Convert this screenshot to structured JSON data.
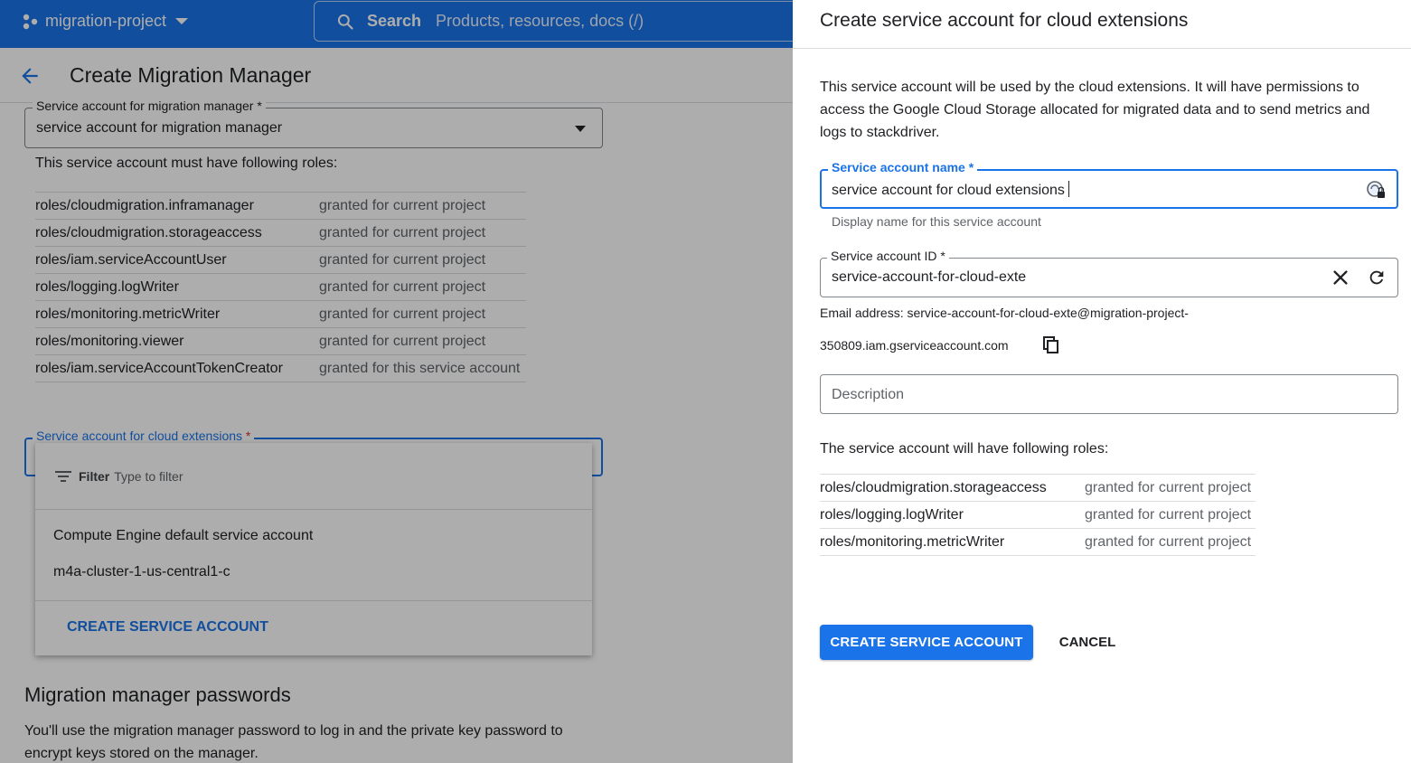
{
  "topbar": {
    "project_name": "migration-project",
    "search_label": "Search",
    "search_placeholder": "Products, resources, docs (/)"
  },
  "page": {
    "title": "Create Migration Manager",
    "migration_sa_field": {
      "label": "Service account for migration manager *",
      "value": "service account for migration manager"
    },
    "must_have_text": "This service account must have following roles:",
    "roles": [
      {
        "role": "roles/cloudmigration.inframanager",
        "scope": "granted for current project"
      },
      {
        "role": "roles/cloudmigration.storageaccess",
        "scope": "granted for current project"
      },
      {
        "role": "roles/iam.serviceAccountUser",
        "scope": "granted for current project"
      },
      {
        "role": "roles/logging.logWriter",
        "scope": "granted for current project"
      },
      {
        "role": "roles/monitoring.metricWriter",
        "scope": "granted for current project"
      },
      {
        "role": "roles/monitoring.viewer",
        "scope": "granted for current project"
      },
      {
        "role": "roles/iam.serviceAccountTokenCreator",
        "scope": "granted for this service account"
      }
    ],
    "cloud_ext_field": {
      "label": "Service account for cloud extensions",
      "required_mark": "*"
    },
    "dropdown": {
      "filter_label": "Filter",
      "filter_placeholder": "Type to filter",
      "options": [
        "Compute Engine default service account",
        "m4a-cluster-1-us-central1-c"
      ],
      "create_label": "CREATE SERVICE ACCOUNT"
    },
    "passwords_heading": "Migration manager passwords",
    "passwords_text": "You'll use the migration manager password to log in and the private key password to encrypt keys stored on the manager."
  },
  "panel": {
    "title": "Create service account for cloud extensions",
    "description": "This service account will be used by the cloud extensions. It will have permissions to access the Google Cloud Storage allocated for migrated data and to send metrics and logs to stackdriver.",
    "name_field": {
      "label": "Service account name *",
      "value": "service account for cloud extensions",
      "hint": "Display name for this service account"
    },
    "id_field": {
      "label": "Service account ID *",
      "value": "service-account-for-cloud-exte"
    },
    "email_line1": "Email address: service-account-for-cloud-exte@migration-project-",
    "email_line2": "350809.iam.gserviceaccount.com",
    "description_placeholder": "Description",
    "will_have_text": "The service account will have following roles:",
    "roles": [
      {
        "role": "roles/cloudmigration.storageaccess",
        "scope": "granted for current project"
      },
      {
        "role": "roles/logging.logWriter",
        "scope": "granted for current project"
      },
      {
        "role": "roles/monitoring.metricWriter",
        "scope": "granted for current project"
      }
    ],
    "create_button": "CREATE SERVICE ACCOUNT",
    "cancel_button": "CANCEL"
  },
  "colors": {
    "accent": "#1a73e8",
    "required": "#d93025",
    "secondary_text": "#5f6368"
  }
}
